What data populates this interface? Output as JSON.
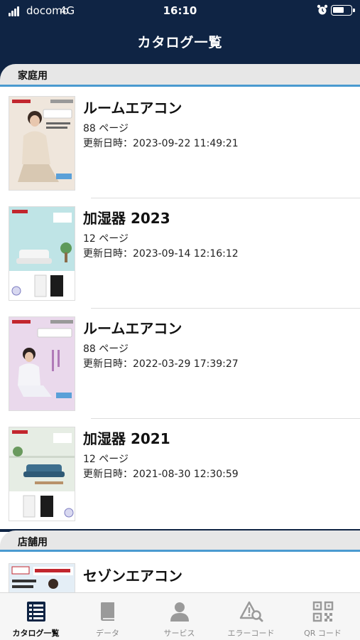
{
  "status": {
    "carrier": "docomo",
    "network": "4G",
    "time": "16:10"
  },
  "nav": {
    "title": "カタログ一覧"
  },
  "sections": [
    {
      "label": "家庭用",
      "items": [
        {
          "name": "ルームエアコン",
          "pages": "88 ページ",
          "updated": "更新日時：2023-09-22 11:49:21",
          "thumb": "aircon"
        },
        {
          "name": "加湿器 2023",
          "pages": "12 ページ",
          "updated": "更新日時：2023-09-14 12:16:12",
          "thumb": "humidifier"
        },
        {
          "name": "ルームエアコン",
          "pages": "88 ページ",
          "updated": "更新日時：2022-03-29 17:39:27",
          "thumb": "aircon"
        },
        {
          "name": "加湿器 2021",
          "pages": "12 ページ",
          "updated": "更新日時：2021-08-30 12:30:59",
          "thumb": "humidifier"
        }
      ]
    },
    {
      "label": "店舗用",
      "items": [
        {
          "name": "セゾンエアコン",
          "pages": "",
          "updated": "",
          "thumb": "store"
        }
      ]
    }
  ],
  "tabs": [
    {
      "label": "カタログ一覧",
      "icon": "catalog-icon",
      "active": true
    },
    {
      "label": "データ",
      "icon": "book-icon",
      "active": false
    },
    {
      "label": "サービス",
      "icon": "person-icon",
      "active": false
    },
    {
      "label": "エラーコード",
      "icon": "error-search-icon",
      "active": false
    },
    {
      "label": "QR コード",
      "icon": "qr-code-icon",
      "active": false
    }
  ],
  "colors": {
    "header": "#0f2444",
    "accent": "#4a9ad0",
    "section_bg": "#e7e7e7"
  }
}
